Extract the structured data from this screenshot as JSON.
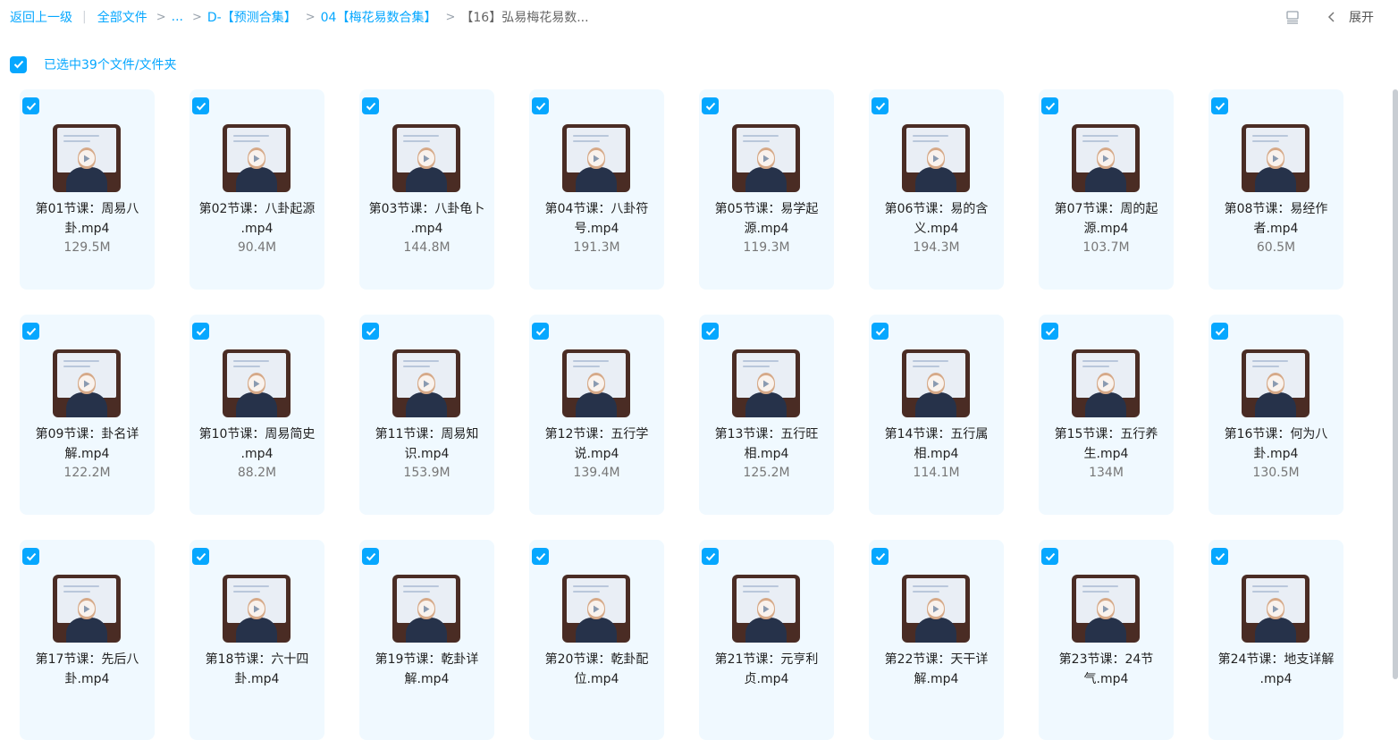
{
  "breadcrumb": {
    "back": "返回上一级",
    "pipe": "|",
    "root": "全部文件",
    "sep": ">",
    "ellipsis": "...",
    "items": [
      "D-【预测合集】",
      "04【梅花易数合集】"
    ],
    "current": "【16】弘易梅花易数..."
  },
  "toolbar": {
    "expand_label": "展开",
    "view_icon": "list-view-icon",
    "collapse_icon": "chevron-left-icon"
  },
  "selection": {
    "text": "已选中39个文件/文件夹",
    "checked": true
  },
  "accent_color": "#06a7ff",
  "card_bg": "#f0f9ff",
  "files": [
    {
      "name": "第01节课：周易八卦.mp4",
      "size": "129.5M",
      "checked": true
    },
    {
      "name": "第02节课：八卦起源 .mp4",
      "size": "90.4M",
      "checked": true
    },
    {
      "name": "第03节课：八卦龟卜 .mp4",
      "size": "144.8M",
      "checked": true
    },
    {
      "name": "第04节课：八卦符号.mp4",
      "size": "191.3M",
      "checked": true
    },
    {
      "name": "第05节课：易学起源.mp4",
      "size": "119.3M",
      "checked": true
    },
    {
      "name": "第06节课：易的含义.mp4",
      "size": "194.3M",
      "checked": true
    },
    {
      "name": "第07节课：周的起源.mp4",
      "size": "103.7M",
      "checked": true
    },
    {
      "name": "第08节课：易经作者.mp4",
      "size": "60.5M",
      "checked": true
    },
    {
      "name": "第09节课：卦名详解.mp4",
      "size": "122.2M",
      "checked": true
    },
    {
      "name": "第10节课：周易简史 .mp4",
      "size": "88.2M",
      "checked": true
    },
    {
      "name": "第11节课：周易知识.mp4",
      "size": "153.9M",
      "checked": true
    },
    {
      "name": "第12节课：五行学说.mp4",
      "size": "139.4M",
      "checked": true
    },
    {
      "name": "第13节课：五行旺相.mp4",
      "size": "125.2M",
      "checked": true
    },
    {
      "name": "第14节课：五行属相.mp4",
      "size": "114.1M",
      "checked": true
    },
    {
      "name": "第15节课：五行养生.mp4",
      "size": "134M",
      "checked": true
    },
    {
      "name": "第16节课：何为八卦.mp4",
      "size": "130.5M",
      "checked": true
    },
    {
      "name": "第17节课：先后八卦.mp4",
      "size": "",
      "checked": true
    },
    {
      "name": "第18节课：六十四卦.mp4",
      "size": "",
      "checked": true
    },
    {
      "name": "第19节课：乾卦详解.mp4",
      "size": "",
      "checked": true
    },
    {
      "name": "第20节课：乾卦配位.mp4",
      "size": "",
      "checked": true
    },
    {
      "name": "第21节课：元亨利贞.mp4",
      "size": "",
      "checked": true
    },
    {
      "name": "第22节课：天干详解.mp4",
      "size": "",
      "checked": true
    },
    {
      "name": "第23节课：24节气.mp4",
      "size": "",
      "checked": true
    },
    {
      "name": "第24节课：地支详解 .mp4",
      "size": "",
      "checked": true
    }
  ]
}
